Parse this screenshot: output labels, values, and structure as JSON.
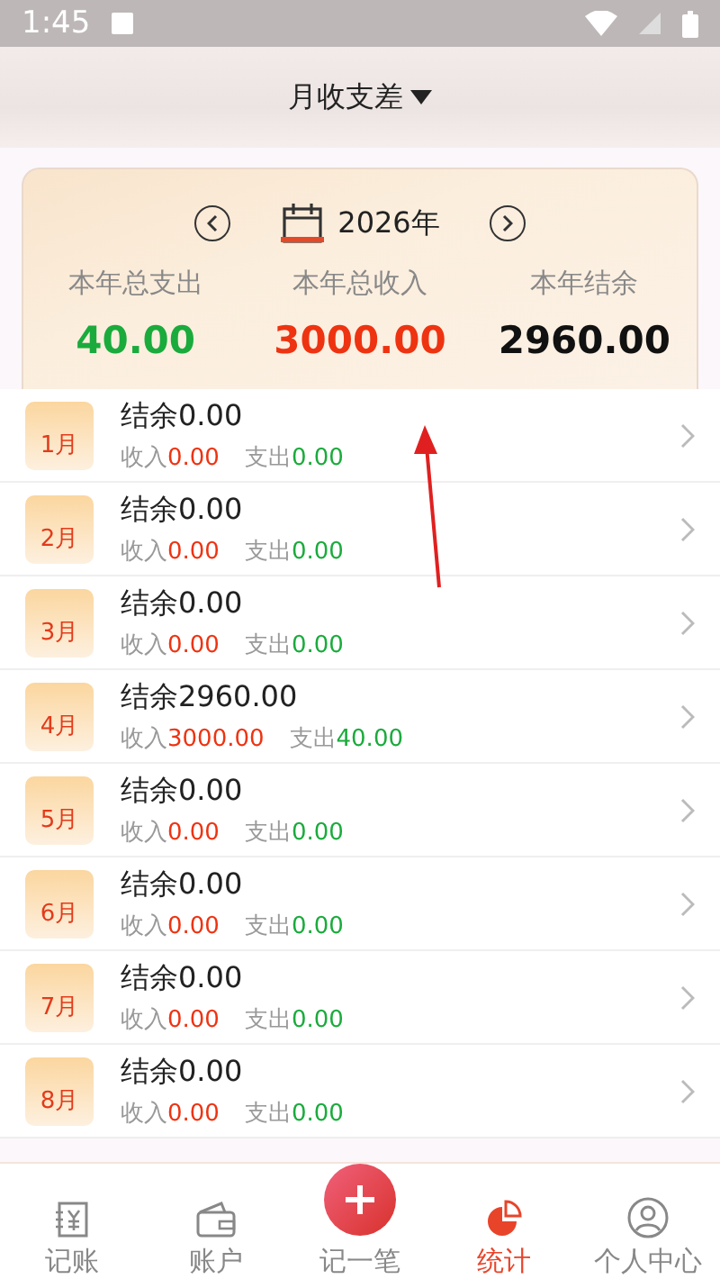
{
  "status_bar": {
    "time": "1:45"
  },
  "header": {
    "title": "月收支差",
    "has_dropdown": true
  },
  "year_card": {
    "year": "2026年",
    "stats": [
      {
        "label": "本年总支出",
        "value": "40.00",
        "color": "#1aab3c"
      },
      {
        "label": "本年总收入",
        "value": "3000.00",
        "color": "#ee3311"
      },
      {
        "label": "本年结余",
        "value": "2960.00",
        "color": "#111111"
      }
    ]
  },
  "months": [
    {
      "month": "1月",
      "balance": "结余0.00",
      "income_label": "收入",
      "income": "0.00",
      "expense_label": "支出",
      "expense": "0.00"
    },
    {
      "month": "2月",
      "balance": "结余0.00",
      "income_label": "收入",
      "income": "0.00",
      "expense_label": "支出",
      "expense": "0.00"
    },
    {
      "month": "3月",
      "balance": "结余0.00",
      "income_label": "收入",
      "income": "0.00",
      "expense_label": "支出",
      "expense": "0.00"
    },
    {
      "month": "4月",
      "balance": "结余2960.00",
      "income_label": "收入",
      "income": "3000.00",
      "expense_label": "支出",
      "expense": "40.00"
    },
    {
      "month": "5月",
      "balance": "结余0.00",
      "income_label": "收入",
      "income": "0.00",
      "expense_label": "支出",
      "expense": "0.00"
    },
    {
      "month": "6月",
      "balance": "结余0.00",
      "income_label": "收入",
      "income": "0.00",
      "expense_label": "支出",
      "expense": "0.00"
    },
    {
      "month": "7月",
      "balance": "结余0.00",
      "income_label": "收入",
      "income": "0.00",
      "expense_label": "支出",
      "expense": "0.00"
    },
    {
      "month": "8月",
      "balance": "结余0.00",
      "income_label": "收入",
      "income": "0.00",
      "expense_label": "支出",
      "expense": "0.00"
    }
  ],
  "bottom_nav": [
    {
      "label": "记账",
      "kind": "tab",
      "selected": false
    },
    {
      "label": "账户",
      "kind": "tab",
      "selected": false
    },
    {
      "label": "记一笔",
      "kind": "add",
      "selected": false
    },
    {
      "label": "统计",
      "kind": "tab",
      "selected": true
    },
    {
      "label": "个人中心",
      "kind": "tab",
      "selected": false
    }
  ]
}
